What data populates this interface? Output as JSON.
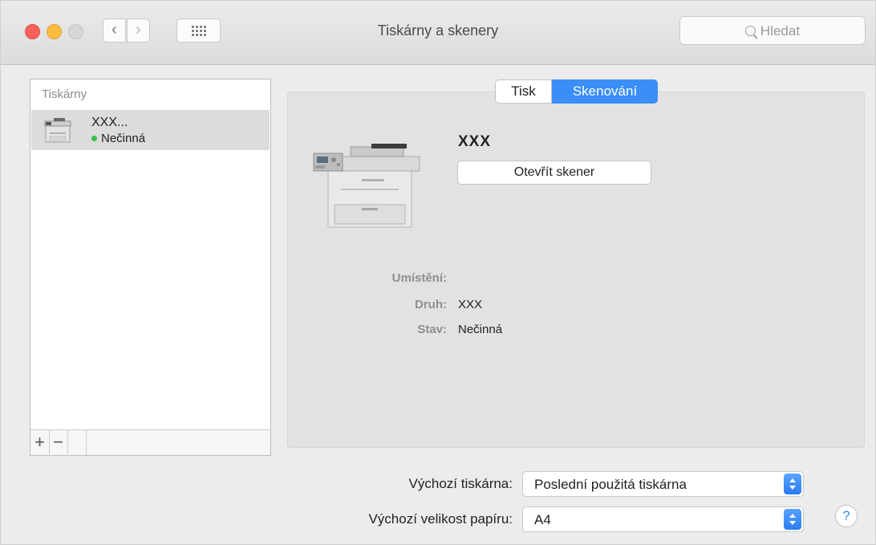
{
  "window": {
    "title": "Tiskárny a skenery",
    "search_placeholder": "Hledat",
    "nav_back_glyph": "‹",
    "nav_forward_glyph": "›"
  },
  "sidebar": {
    "header": "Tiskárny",
    "printers": [
      {
        "name": "XXX...",
        "status": "Nečinná",
        "status_color": "#31c14d",
        "selected": true
      }
    ],
    "add_label": "+",
    "remove_label": "−"
  },
  "tabs": [
    {
      "label": "Tisk",
      "selected": false
    },
    {
      "label": "Skenování",
      "selected": true
    }
  ],
  "device": {
    "name": "XXX",
    "open_scanner_label": "Otevřít skener",
    "info": [
      {
        "label": "Umístění:",
        "value": ""
      },
      {
        "label": "Druh:",
        "value": "XXX"
      },
      {
        "label": "Stav:",
        "value": "Nečinná"
      }
    ]
  },
  "settings": {
    "default_printer_label": "Výchozí tiskárna:",
    "default_printer_value": "Poslední použitá tiskárna",
    "default_paper_label": "Výchozí velikost papíru:",
    "default_paper_value": "A4"
  },
  "help_label": "?",
  "colors": {
    "accent": "#3a8ef6",
    "traffic_close": "#fc605b",
    "traffic_minimize": "#fdbc40",
    "status_idle": "#31c14d"
  },
  "icons": {
    "grid": "grid-icon",
    "search": "search-icon",
    "printer": "printer-icon"
  }
}
